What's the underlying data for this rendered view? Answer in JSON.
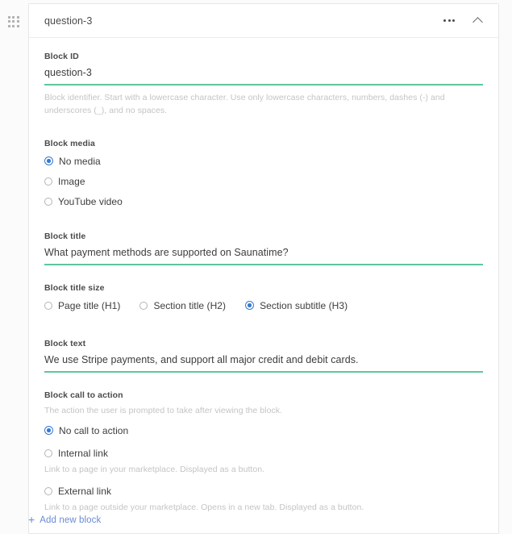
{
  "block": {
    "header": {
      "title": "question-3",
      "more_icon": "ellipsis-icon",
      "collapse_icon": "chevron-up-icon",
      "drag_icon": "drag-handle-icon"
    },
    "fields": {
      "block_id": {
        "label": "Block ID",
        "value": "question-3",
        "helper": "Block identifier. Start with a lowercase character. Use only lowercase characters, numbers, dashes (-) and underscores (_), and no spaces."
      },
      "block_media": {
        "label": "Block media",
        "options": [
          {
            "label": "No media",
            "checked": true
          },
          {
            "label": "Image",
            "checked": false
          },
          {
            "label": "YouTube video",
            "checked": false
          }
        ]
      },
      "block_title": {
        "label": "Block title",
        "value": "What payment methods are supported on Saunatime?"
      },
      "block_title_size": {
        "label": "Block title size",
        "options": [
          {
            "label": "Page title (H1)",
            "checked": false
          },
          {
            "label": "Section title (H2)",
            "checked": false
          },
          {
            "label": "Section subtitle (H3)",
            "checked": true
          }
        ]
      },
      "block_text": {
        "label": "Block text",
        "value": "We use Stripe payments, and support all major credit and debit cards."
      },
      "block_cta": {
        "label": "Block call to action",
        "description": "The action the user is prompted to take after viewing the block.",
        "options": [
          {
            "label": "No call to action",
            "checked": true,
            "sub": ""
          },
          {
            "label": "Internal link",
            "checked": false,
            "sub": "Link to a page in your marketplace. Displayed as a button."
          },
          {
            "label": "External link",
            "checked": false,
            "sub": "Link to a page outside your marketplace. Opens in a new tab. Displayed as a button."
          }
        ]
      }
    }
  },
  "footer": {
    "add_new_block_label": "Add new block",
    "add_icon": "plus-icon"
  },
  "colors": {
    "accent_green": "#5ec79c",
    "accent_blue": "#3779d2",
    "link_blue": "#6a8bd4",
    "page_bg": "#fbfbfb",
    "card_bg": "#ffffff",
    "border": "#e7e7e7",
    "helper_text": "#c4c4c4"
  }
}
